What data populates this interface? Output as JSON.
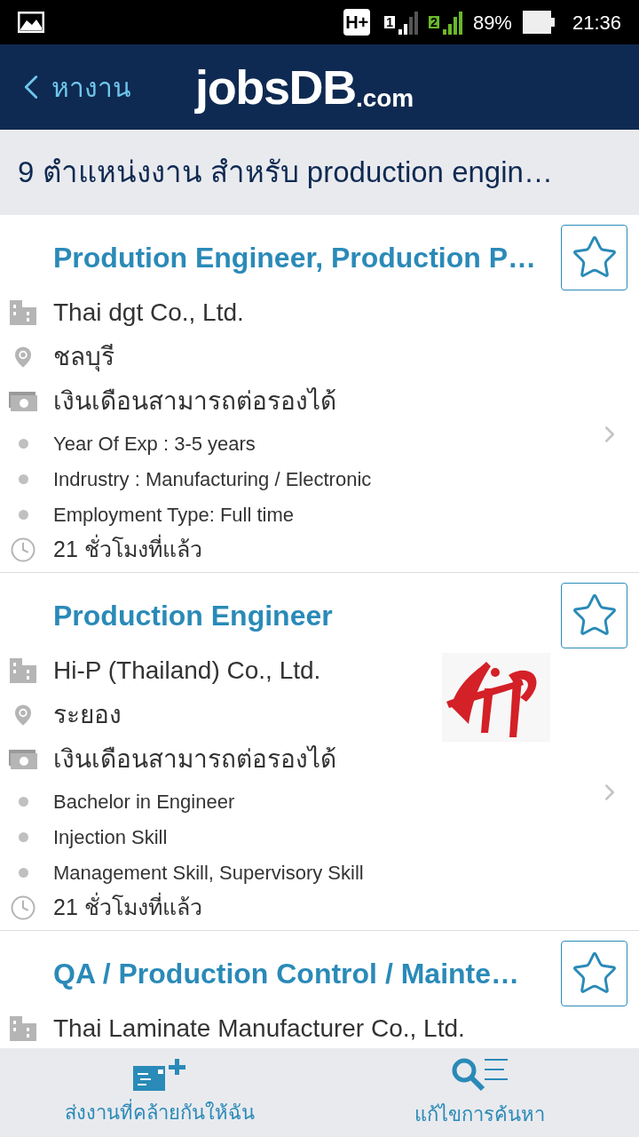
{
  "status_bar": {
    "network": "H+",
    "sim_1": "1",
    "sim_2": "2",
    "battery": "89%",
    "time": "21:36"
  },
  "header": {
    "back_label": "หางาน",
    "logo": {
      "main": "jobsDB",
      "suffix": ".com"
    }
  },
  "results_title": "9 ตำแหน่งงาน สำหรับ production engin…",
  "jobs": [
    {
      "title": "Prodution Engineer, Production P…",
      "saved": false,
      "company": "Thai dgt Co., Ltd.",
      "location": "ชลบุรี",
      "salary": "เงินเดือนสามารถต่อรองได้",
      "highlights": [
        "Year Of Exp : 3-5 years",
        "Indrustry : Manufacturing / Electronic",
        "Employment Type: Full time"
      ],
      "posted": "21 ชั่วโมงที่แล้ว"
    },
    {
      "title": "Production Engineer",
      "saved": false,
      "company": "Hi-P (Thailand) Co., Ltd.",
      "location": "ระยอง",
      "salary": "เงินเดือนสามารถต่อรองได้",
      "highlights": [
        "Bachelor in Engineer",
        "Injection Skill",
        "Management Skill, Supervisory Skill"
      ],
      "posted": "21 ชั่วโมงที่แล้ว"
    },
    {
      "title": "QA / Production Control / Mainte…",
      "saved": false,
      "company": "Thai Laminate Manufacturer Co., Ltd."
    }
  ],
  "bottom_bar": [
    {
      "kind": "send_similar",
      "label": "ส่งงานที่คล้ายกันให้ฉัน"
    },
    {
      "kind": "edit_search",
      "label": "แก้ไขการค้นหา"
    }
  ]
}
